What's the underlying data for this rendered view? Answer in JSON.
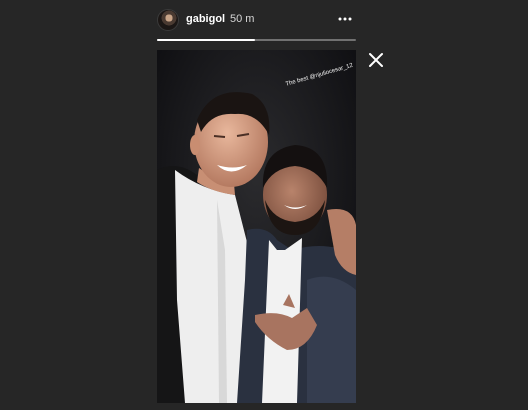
{
  "story": {
    "username": "gabigol",
    "time_ago": "50 m",
    "caption": "The best @njuliocesar_12",
    "progress": 0.49
  },
  "icons": {
    "more": "more-options-icon",
    "close": "close-icon"
  },
  "colors": {
    "background": "#262626",
    "text": "#ffffff"
  }
}
